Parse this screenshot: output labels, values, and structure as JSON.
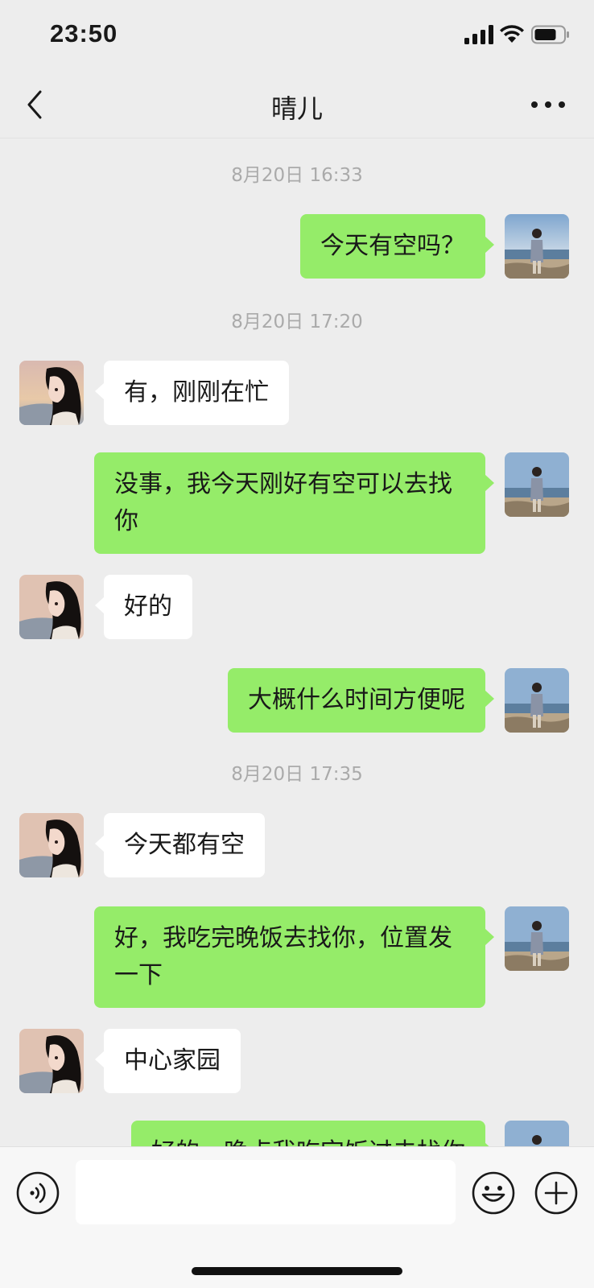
{
  "status_bar": {
    "time": "23:50"
  },
  "header": {
    "title": "晴儿"
  },
  "messages": [
    {
      "type": "time",
      "text": "8月20日 16:33"
    },
    {
      "type": "msg",
      "from": "me",
      "text": "今天有空吗？"
    },
    {
      "type": "time",
      "text": "8月20日 17:20"
    },
    {
      "type": "msg",
      "from": "her",
      "text": "有，刚刚在忙"
    },
    {
      "type": "msg",
      "from": "me",
      "text": "没事，我今天刚好有空可以去找你"
    },
    {
      "type": "msg",
      "from": "her",
      "text": "好的"
    },
    {
      "type": "msg",
      "from": "me",
      "text": "大概什么时间方便呢"
    },
    {
      "type": "time",
      "text": "8月20日 17:35"
    },
    {
      "type": "msg",
      "from": "her",
      "text": "今天都有空"
    },
    {
      "type": "msg",
      "from": "me",
      "text": "好，我吃完晚饭去找你，位置发一下"
    },
    {
      "type": "msg",
      "from": "her",
      "text": "中心家园"
    },
    {
      "type": "msg",
      "from": "me",
      "text": "好的，晚点我吃完饭过去找你"
    }
  ],
  "input_bar": {
    "placeholder": ""
  },
  "icons": {
    "back": "chevron-left-icon",
    "more": "more-horizontal-icon",
    "voice": "voice-icon",
    "emoji": "emoji-icon",
    "plus": "plus-icon"
  },
  "colors": {
    "background": "#EDEDED",
    "my_bubble": "#95EC69",
    "her_bubble": "#FFFFFF",
    "timestamp": "#AAAAAA"
  }
}
